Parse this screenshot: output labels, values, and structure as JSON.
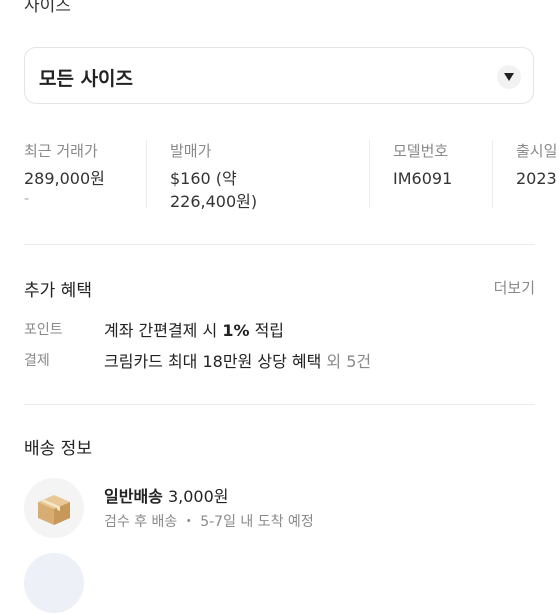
{
  "size_section": {
    "heading": "사이즈",
    "selected": "모든 사이즈",
    "dropdown_icon": "triangle-down-icon"
  },
  "product_info": [
    {
      "label": "최근 거래가",
      "value": "289,000원",
      "sub": "-"
    },
    {
      "label": "발매가",
      "value_line1": "$160 (약",
      "value_line2": "226,400원)"
    },
    {
      "label": "모델번호",
      "value": "IM6091"
    },
    {
      "label": "출시일",
      "value": "2023"
    }
  ],
  "benefits": {
    "title": "추가 혜택",
    "more": "더보기",
    "items": [
      {
        "label": "포인트",
        "text_pre": "계좌 간편결제 시 ",
        "text_bold": "1%",
        "text_post": " 적립"
      },
      {
        "label": "결제",
        "text": "크림카드 최대 18만원 상당 혜택",
        "extra": " 외 5건"
      }
    ]
  },
  "shipping": {
    "title": "배송 정보",
    "options": [
      {
        "icon": "box-icon",
        "name": "일반배송",
        "price": "3,000원",
        "detail": "검수 후 배송 ・ 5-7일 내 도착 예정"
      }
    ]
  }
}
